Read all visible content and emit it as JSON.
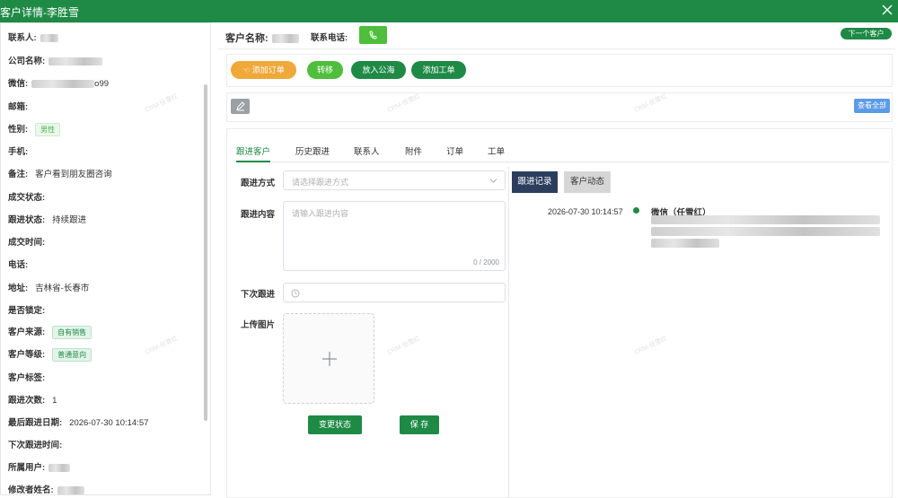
{
  "window": {
    "title": "客户详情-李胜雪"
  },
  "left_panel": {
    "fields": [
      {
        "label": "联系人:",
        "value": ""
      },
      {
        "label": "公司名称:",
        "value": ""
      },
      {
        "label": "微信:",
        "value": "o99"
      },
      {
        "label": "邮箱:",
        "value": ""
      },
      {
        "label": "性别:",
        "value": "男性"
      },
      {
        "label": "手机:",
        "value": ""
      },
      {
        "label": "备注:",
        "value": "客户看到朋友圈咨询"
      },
      {
        "label": "成交状态:",
        "value": ""
      },
      {
        "label": "跟进状态:",
        "value": "持续跟进"
      },
      {
        "label": "成交时间:",
        "value": ""
      },
      {
        "label": "电话:",
        "value": ""
      },
      {
        "label": "地址:",
        "value": "吉林省-长春市"
      },
      {
        "label": "是否锁定:",
        "value": ""
      },
      {
        "label": "客户来源:",
        "value": "自有销售"
      },
      {
        "label": "客户等级:",
        "value": "普通意向"
      },
      {
        "label": "客户标签:",
        "value": ""
      },
      {
        "label": "跟进次数:",
        "value": "1"
      },
      {
        "label": "最后跟进日期:",
        "value": "2026-07-30 10:14:57"
      },
      {
        "label": "下次跟进时间:",
        "value": ""
      },
      {
        "label": "所属用户:",
        "value": ""
      },
      {
        "label": "修改者姓名:",
        "value": ""
      }
    ]
  },
  "header": {
    "customer_name_label": "客户名称:",
    "phone_label": "联系电话:",
    "next_customer": "下一个客户"
  },
  "actions": {
    "add_order": "添加订单",
    "transfer": "转移",
    "to_public": "放入公海",
    "add_ticket": "添加工单"
  },
  "toolbar": {
    "view_all": "查看全部"
  },
  "tabs": [
    "跟进客户",
    "历史跟进",
    "联系人",
    "附件",
    "订单",
    "工单"
  ],
  "form": {
    "method_label": "跟进方式",
    "method_placeholder": "请选择跟进方式",
    "content_label": "跟进内容",
    "content_placeholder": "请输入跟进内容",
    "content_counter": "0 / 2000",
    "next_label": "下次跟进",
    "upload_label": "上传图片",
    "change_status": "变更状态",
    "save": "保 存"
  },
  "right_panel": {
    "tab_records": "跟进记录",
    "tab_dynamics": "客户动态",
    "record": {
      "time": "2026-07-30 10:14:57",
      "title": "微信（任雪红）"
    }
  },
  "watermark": "CRM-任雪红",
  "colors": {
    "primary": "#1e8a46",
    "orange": "#f0a83a",
    "light_green": "#4fbe3c",
    "navy": "#2c3e5e",
    "blue": "#5b9be6"
  },
  "icons": [
    "close-icon",
    "phone-icon",
    "hand-icon",
    "edit-icon",
    "chevron-down-icon",
    "clock-icon",
    "plus-icon"
  ]
}
